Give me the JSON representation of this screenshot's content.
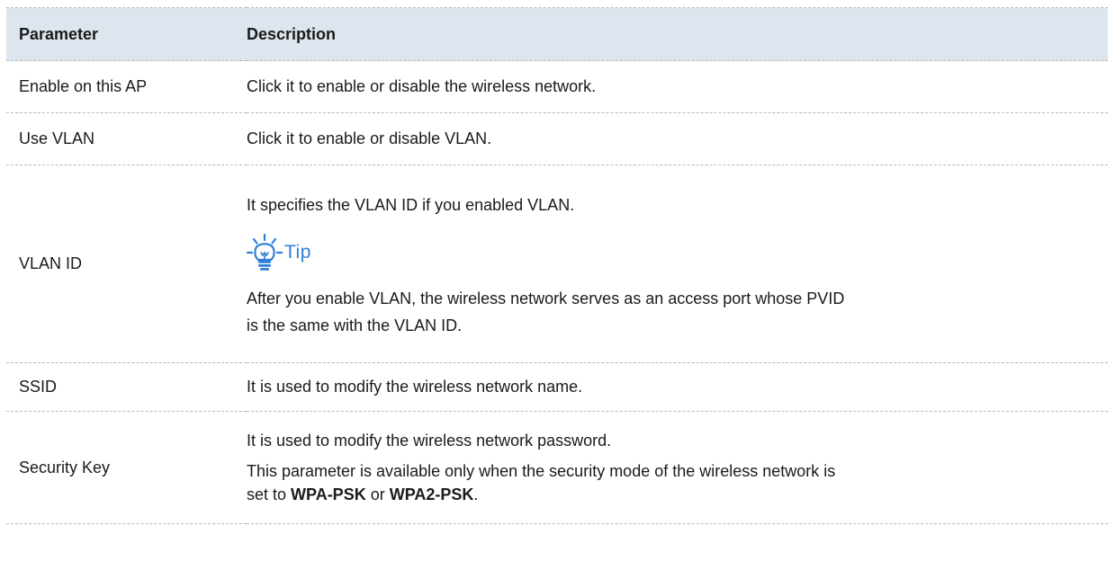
{
  "headers": {
    "param": "Parameter",
    "desc": "Description"
  },
  "rows": {
    "enable": {
      "param": "Enable on this AP",
      "desc": "Click it to enable or disable the wireless network."
    },
    "use_vlan": {
      "param": "Use VLAN",
      "desc": "Click it to enable or disable VLAN."
    },
    "vlan_id": {
      "param": "VLAN ID",
      "desc": "It specifies the VLAN ID if you enabled VLAN.",
      "tip_label": "Tip",
      "tip_icon": "lightbulb-icon",
      "tip_text_1": "After you enable VLAN, the wireless network serves as an access port whose PVID",
      "tip_text_2": "is the same with the VLAN ID."
    },
    "ssid": {
      "param": "SSID",
      "desc": "It is used to modify the wireless network name."
    },
    "security_key": {
      "param": "Security Key",
      "desc_1": "It is used to modify the wireless network password.",
      "desc_2": "This parameter is available only when the security mode of the wireless network is",
      "desc_3a": "set to ",
      "desc_3b": "WPA-PSK",
      "desc_3c": " or ",
      "desc_3d": "WPA2-PSK",
      "desc_3e": "."
    }
  },
  "colors": {
    "header_bg": "#dde5ee",
    "tip_blue": "#2f7ed8",
    "divider": "#b8b8b8"
  }
}
